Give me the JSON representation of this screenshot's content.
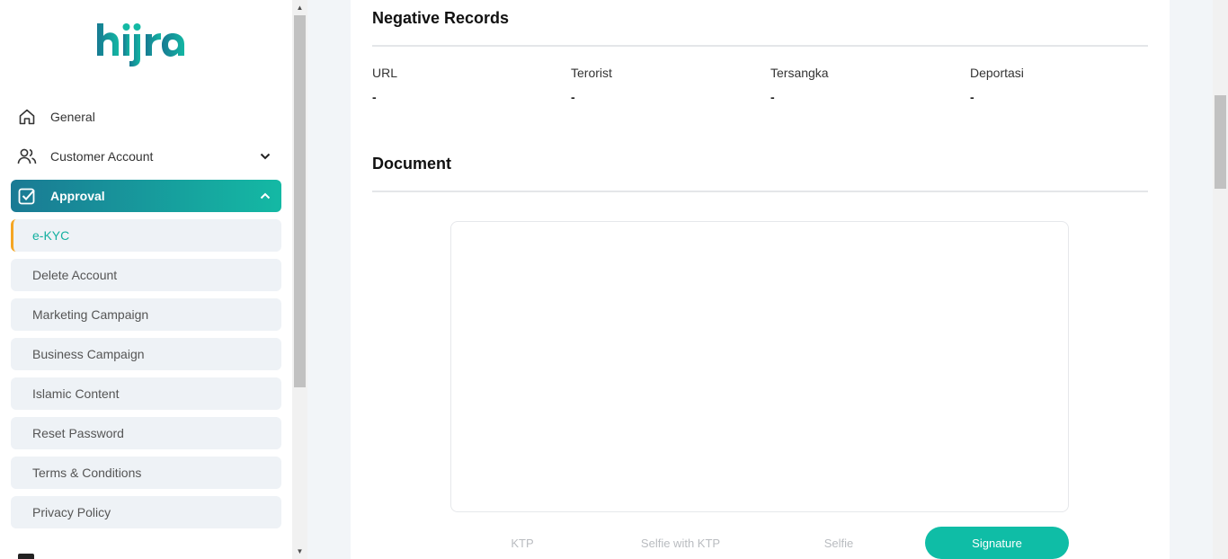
{
  "brand": {
    "logo_text": "hijra",
    "color_primary": "#1a7a94",
    "color_accent": "#14b9a4"
  },
  "sidebar": {
    "nav": [
      {
        "label": "General",
        "icon": "home-icon"
      },
      {
        "label": "Customer Account",
        "icon": "users-icon",
        "expanded": false
      },
      {
        "label": "Approval",
        "icon": "checkbox-icon",
        "expanded": true
      }
    ],
    "approval_items": [
      {
        "label": "e-KYC",
        "active": true
      },
      {
        "label": "Delete Account"
      },
      {
        "label": "Marketing Campaign"
      },
      {
        "label": "Business Campaign"
      },
      {
        "label": "Islamic Content"
      },
      {
        "label": "Reset Password"
      },
      {
        "label": "Terms & Conditions"
      },
      {
        "label": "Privacy Policy"
      }
    ]
  },
  "negative_records": {
    "title": "Negative Records",
    "fields": [
      {
        "label": "URL",
        "value": "-"
      },
      {
        "label": "Terorist",
        "value": "-"
      },
      {
        "label": "Tersangka",
        "value": "-"
      },
      {
        "label": "Deportasi",
        "value": "-"
      }
    ]
  },
  "document": {
    "title": "Document",
    "tabs": [
      {
        "label": "KTP"
      },
      {
        "label": "Selfie with KTP"
      },
      {
        "label": "Selfie"
      },
      {
        "label": "Signature",
        "active": true
      }
    ]
  }
}
